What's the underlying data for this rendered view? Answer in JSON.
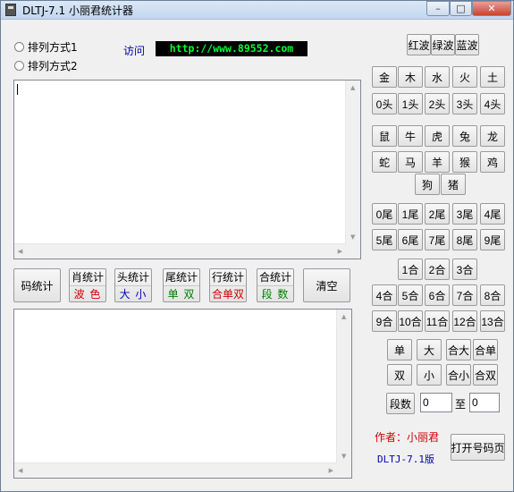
{
  "window": {
    "title": "DLTJ-7.1 小丽君统计器",
    "controls": {
      "minimize": "–",
      "maximize": "□",
      "close": "✕"
    },
    "icon": "calculator-icon"
  },
  "options": {
    "mode1": "排列方式1",
    "mode2": "排列方式2"
  },
  "header": {
    "visit_label": "访问",
    "url": "http://www.89552.com"
  },
  "colors": {
    "red": "#d00000",
    "blue": "#0000c0",
    "green": "#008000",
    "url_bg": "#000000",
    "url_fg": "#00ff33"
  },
  "stats": {
    "code_stat": "码统计",
    "shengxiao_top": "肖统计",
    "shengxiao_bot": "波 色",
    "tou_top": "头统计",
    "tou_bot": "大 小",
    "wei_top": "尾统计",
    "wei_bot": "单 双",
    "hang_top": "行统计",
    "hang_bot": "合单双",
    "he_top": "合统计",
    "he_bot": "段 数",
    "clear": "清空"
  },
  "right_panel": {
    "waves": [
      "红波",
      "绿波",
      "蓝波"
    ],
    "elements": [
      "金",
      "木",
      "水",
      "火",
      "土"
    ],
    "heads": [
      "0头",
      "1头",
      "2头",
      "3头",
      "4头"
    ],
    "zodiac_row1": [
      "鼠",
      "牛",
      "虎",
      "兔",
      "龙"
    ],
    "zodiac_row2": [
      "蛇",
      "马",
      "羊",
      "猴",
      "鸡"
    ],
    "zodiac_row3": [
      "狗",
      "猪"
    ],
    "tails_row1": [
      "0尾",
      "1尾",
      "2尾",
      "3尾",
      "4尾"
    ],
    "tails_row2": [
      "5尾",
      "6尾",
      "7尾",
      "8尾",
      "9尾"
    ],
    "sums_row1": [
      "1合",
      "2合",
      "3合"
    ],
    "sums_row2": [
      "4合",
      "5合",
      "6合",
      "7合",
      "8合"
    ],
    "sums_row3": [
      "9合",
      "10合",
      "11合",
      "12合",
      "13合"
    ],
    "parity_row1": [
      "单",
      "大",
      "合大",
      "合单"
    ],
    "parity_row2": [
      "双",
      "小",
      "合小",
      "合双"
    ],
    "segment_label": "段数",
    "segment_from": "0",
    "to_label": "至",
    "segment_to": "0",
    "author": "作者：小丽君",
    "version": "DLTJ-7.1版",
    "open_page": "打开号码页"
  }
}
